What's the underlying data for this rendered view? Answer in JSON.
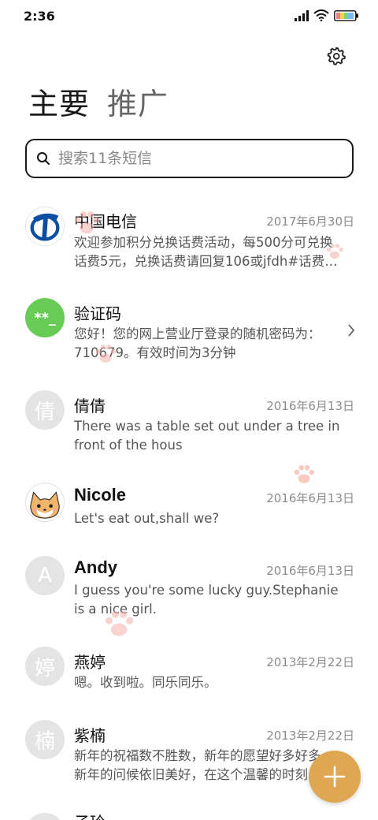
{
  "status_bar": {
    "time": "2:36"
  },
  "tabs": [
    {
      "label": "主要"
    },
    {
      "label": "推广"
    }
  ],
  "search": {
    "placeholder": "搜索11条短信"
  },
  "messages": [
    {
      "name": "中国电信",
      "date": "2017年6月30日",
      "line1": "欢迎参加积分兑换话费活动，每500分可兑换",
      "line2": "话费5元，兑换话费请回复106或jfdh#话费…"
    },
    {
      "name": "验证码",
      "avatar_text": "**_",
      "line1": "您好！您的网上营业厅登录的随机密码为：",
      "line2": "710679。有效时间为3分钟"
    },
    {
      "name": "倩倩",
      "avatar_text": "倩",
      "date": "2016年6月13日",
      "line1": "There was a table set out under a tree in",
      "line2": "front of the hous"
    },
    {
      "name": "Nicole",
      "date": "2016年6月13日",
      "line1": "Let's eat out,shall we?"
    },
    {
      "name": "Andy",
      "avatar_text": "A",
      "date": "2016年6月13日",
      "line1": "I guess you're some lucky guy.Stephanie",
      "line2": "is a nice girl."
    },
    {
      "name": "燕婷",
      "avatar_text": "婷",
      "date": "2013年2月22日",
      "line1": "嗯。收到啦。同乐同乐。"
    },
    {
      "name": "紫楠",
      "avatar_text": "楠",
      "date": "2013年2月22日",
      "line1": "新年的祝福数不胜数，新年的愿望好多好多",
      "line2": "新年的问候依旧美好，在这个温馨的时刻"
    },
    {
      "name": "子玲"
    }
  ],
  "colors": {
    "accent": "#e0a752",
    "verify_avatar": "#66cc55",
    "telecom_blue": "#0b4ea2"
  }
}
